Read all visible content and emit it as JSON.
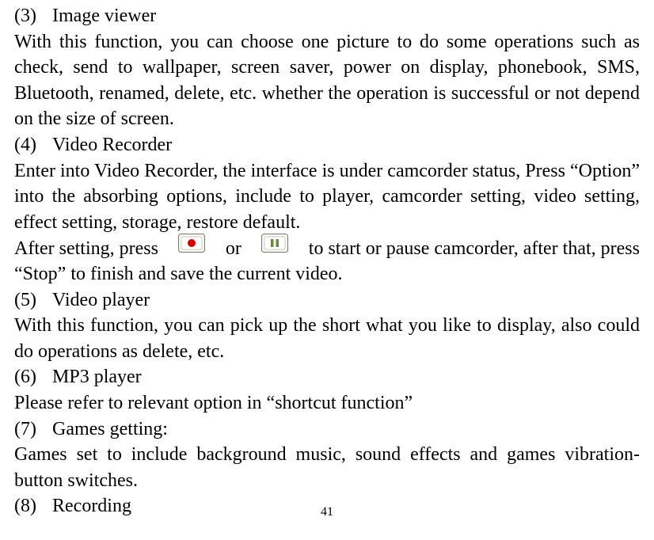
{
  "page_number": "41",
  "sections": {
    "s3": {
      "num": "(3)",
      "title": "Image viewer",
      "body": "With this function, you can choose one picture to do some operations such as check, send to wallpaper, screen saver, power on display, phonebook, SMS, Bluetooth, renamed, delete, etc. whether the operation is successful or not depend on the size of screen."
    },
    "s4": {
      "num": "(4)",
      "title": "Video Recorder",
      "body1": "Enter into Video Recorder, the interface is under camcorder status, Press “Option” into the absorbing options, include to player, camcorder setting, video setting, effect setting, storage, restore default.",
      "body2_a": "After setting, press",
      "body2_b": "or",
      "body2_c": "to start or pause camcorder, after that, press",
      "body2_d": "“Stop” to finish and save the current video."
    },
    "s5": {
      "num": "(5)",
      "title": "Video player",
      "body": "With this function, you can pick up the short what you like to display, also could do operations as delete, etc."
    },
    "s6": {
      "num": "(6)",
      "title": "MP3 player",
      "body": "Please refer to relevant option in “shortcut function”"
    },
    "s7": {
      "num": "(7)",
      "title": "Games getting:",
      "body": "Games set to include background music, sound effects and games vibration-button switches."
    },
    "s8": {
      "num": "(8)",
      "title": "Recording"
    }
  }
}
